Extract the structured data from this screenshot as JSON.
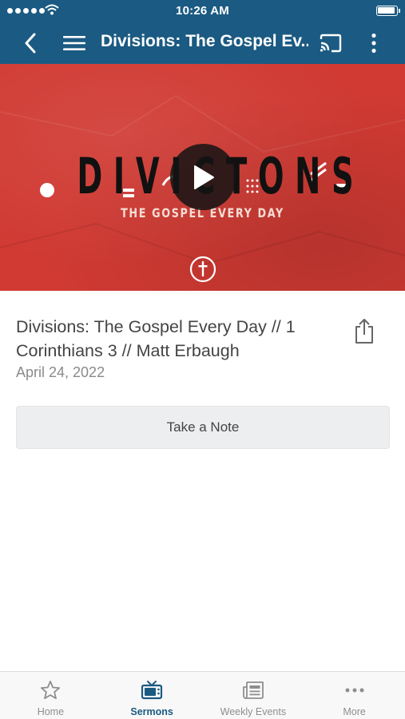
{
  "status_bar": {
    "time": "10:26 AM"
  },
  "nav": {
    "title": "Divisions: The Gospel Ev..."
  },
  "hero": {
    "series_title": "DIVICTONS",
    "subtitle": "THE GOSPEL EVERY DAY"
  },
  "sermon": {
    "title": "Divisions: The Gospel Every Day // 1 Corinthians 3 // Matt Erbaugh",
    "date": "April 24, 2022"
  },
  "actions": {
    "take_note": "Take a Note"
  },
  "tabs": [
    {
      "label": "Home",
      "icon": "star-icon",
      "active": false
    },
    {
      "label": "Sermons",
      "icon": "tv-icon",
      "active": true
    },
    {
      "label": "Weekly Events",
      "icon": "newspaper-icon",
      "active": false
    },
    {
      "label": "More",
      "icon": "ellipsis-icon",
      "active": false
    }
  ],
  "colors": {
    "brand": "#1b5a82",
    "hero": "#d03a33"
  }
}
